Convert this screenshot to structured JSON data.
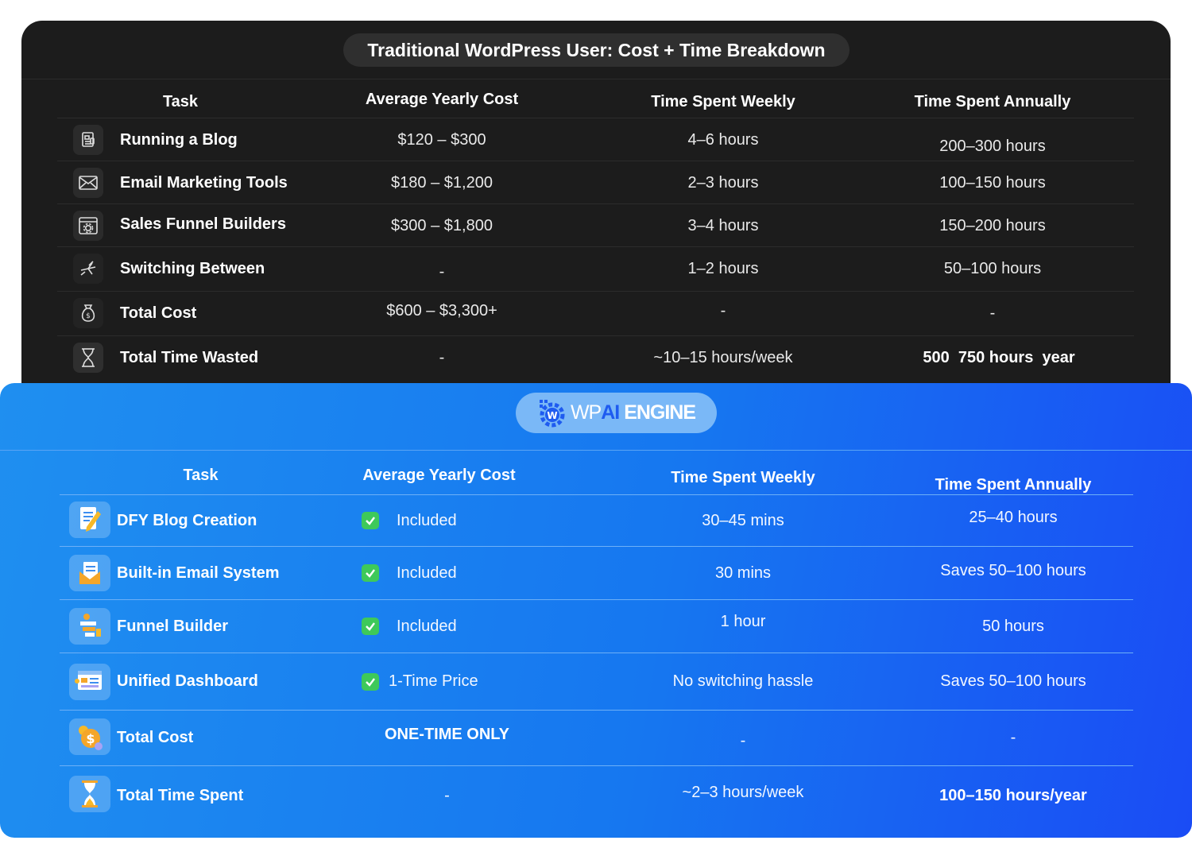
{
  "traditional": {
    "title": "Traditional WordPress User: Cost + Time Breakdown",
    "headers": {
      "task": "Task",
      "cost": "Average Yearly Cost",
      "weekly": "Time Spent Weekly",
      "annually": "Time Spent Annually"
    },
    "rows": [
      {
        "icon": "blog-document-icon",
        "task": "Running a Blog",
        "cost": "$120 – $300",
        "weekly": "4–6 hours",
        "annually": "200–300 hours"
      },
      {
        "icon": "envelope-icon",
        "task": "Email Marketing Tools",
        "cost": "$180 – $1,200",
        "weekly": "2–3 hours",
        "annually": "100–150 hours"
      },
      {
        "icon": "browser-gear-icon",
        "task": "Sales Funnel Builders",
        "cost": "$300 – $1,800",
        "weekly": "3–4 hours",
        "annually": "150–200 hours"
      },
      {
        "icon": "switch-arrows-icon",
        "task": "Switching Between",
        "cost": "-",
        "weekly": "1–2 hours",
        "annually": "50–100 hours"
      },
      {
        "icon": "money-bag-icon",
        "task": "Total Cost",
        "cost": "$600 – $3,300+",
        "weekly": "-",
        "annually": "-"
      },
      {
        "icon": "hourglass-icon",
        "task": "Total Time Wasted",
        "cost": "-",
        "weekly": "~10–15 hours/week",
        "annually": "500  750 hours  year"
      }
    ]
  },
  "wpai": {
    "logo": {
      "wp": "WP",
      "ai": "AI",
      "engine": "ENGINE",
      "badge_letter": "W"
    },
    "headers": {
      "task": "Task",
      "cost": "Average Yearly Cost",
      "weekly": "Time Spent Weekly",
      "annually": "Time Spent Annually"
    },
    "rows": [
      {
        "icon": "blog-pencil-icon",
        "task": "DFY Blog Creation",
        "cost": "Included",
        "weekly": "30–45 mins",
        "annually": "25–40 hours"
      },
      {
        "icon": "email-system-icon",
        "task": "Built-in Email System",
        "cost": "Included",
        "weekly": "30 mins",
        "annually": "Saves 50–100 hours"
      },
      {
        "icon": "funnel-builder-icon",
        "task": "Funnel Builder",
        "cost": "Included",
        "weekly": "1 hour",
        "annually": "50 hours"
      },
      {
        "icon": "dashboard-icon",
        "task": "Unified Dashboard",
        "cost": "1-Time Price",
        "weekly": "No switching hassle",
        "annually": "Saves 50–100 hours"
      },
      {
        "icon": "dollar-coin-icon",
        "task": "Total Cost",
        "cost": "ONE-TIME ONLY",
        "weekly": "-",
        "annually": "-"
      },
      {
        "icon": "hourglass-color-icon",
        "task": "Total Time Spent",
        "cost": "-",
        "weekly": "~2–3 hours/week",
        "annually": "100–150 hours/year"
      }
    ]
  },
  "colors": {
    "dark_bg": "#1c1c1c",
    "blue_start": "#1f8ff0",
    "blue_end": "#1a4cf5",
    "check_green": "#3ec95a"
  }
}
